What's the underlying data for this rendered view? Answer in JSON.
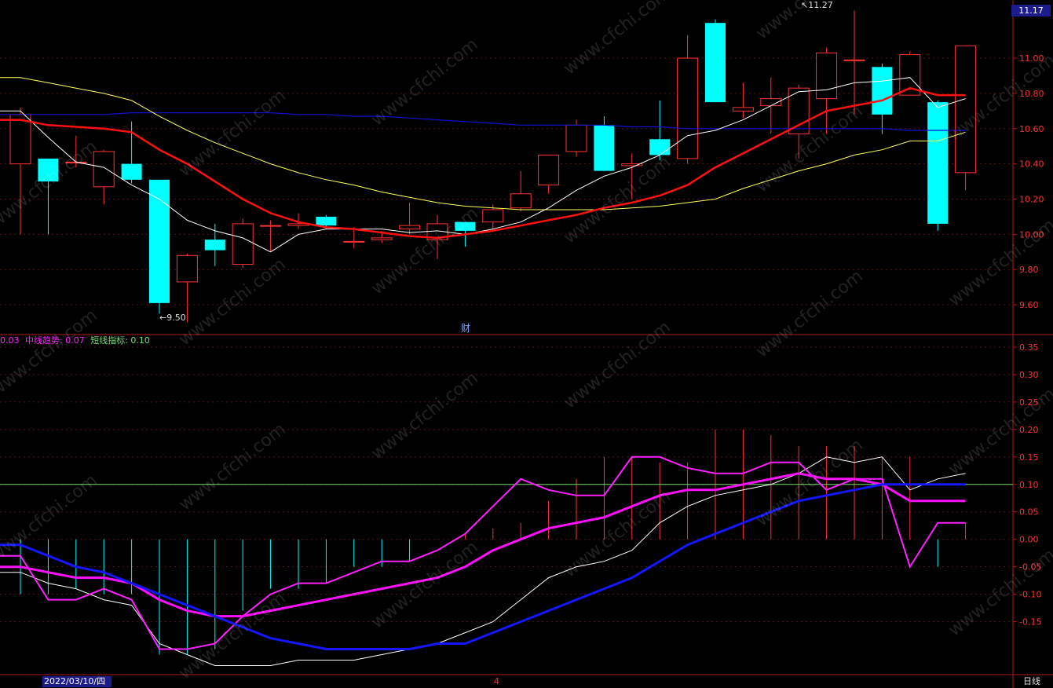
{
  "colors": {
    "up": "#ff3232",
    "down": "#00ffff",
    "ma5": "#ffffff",
    "ma10": "#ff1010",
    "ma20": "#ffff60",
    "ma60": "#1010d0",
    "grid": "#5a1010",
    "axis_text": "#ff3030",
    "ind_white": "#ffffff",
    "ind_magenta": "#ff10ff",
    "ind_purple": "#ff20ff",
    "ind_blue": "#1515ff",
    "ref_line": "#70e070"
  },
  "header": {
    "last_price": "11.17"
  },
  "chart_data": [
    {
      "type": "candlestick",
      "yticks": [
        "11.00",
        "10.80",
        "10.60",
        "10.40",
        "10.20",
        "10.00",
        "9.80",
        "9.60"
      ],
      "ylim": [
        9.44,
        11.33
      ],
      "high_marker": "11.27",
      "low_marker": "9.50",
      "candles": [
        {
          "o": 10.4,
          "h": 10.72,
          "l": 10.0,
          "c": 10.68
        },
        {
          "o": 10.43,
          "h": 10.43,
          "l": 10.0,
          "c": 10.3
        },
        {
          "o": 10.41,
          "h": 10.56,
          "l": 10.38,
          "c": 10.41
        },
        {
          "o": 10.27,
          "h": 10.48,
          "l": 10.17,
          "c": 10.47
        },
        {
          "o": 10.4,
          "h": 10.64,
          "l": 10.29,
          "c": 10.31
        },
        {
          "o": 10.31,
          "h": 10.31,
          "l": 9.55,
          "c": 9.61
        },
        {
          "o": 9.73,
          "h": 9.89,
          "l": 9.5,
          "c": 9.88
        },
        {
          "o": 9.97,
          "h": 10.06,
          "l": 9.82,
          "c": 9.91
        },
        {
          "o": 9.83,
          "h": 10.09,
          "l": 9.81,
          "c": 10.06
        },
        {
          "o": 10.05,
          "h": 10.08,
          "l": 9.9,
          "c": 10.05
        },
        {
          "o": 10.05,
          "h": 10.12,
          "l": 10.03,
          "c": 10.06
        },
        {
          "o": 10.1,
          "h": 10.11,
          "l": 10.03,
          "c": 10.05
        },
        {
          "o": 9.96,
          "h": 10.04,
          "l": 9.92,
          "c": 9.96
        },
        {
          "o": 9.97,
          "h": 10.02,
          "l": 9.95,
          "c": 9.98
        },
        {
          "o": 10.03,
          "h": 10.18,
          "l": 10.0,
          "c": 10.05
        },
        {
          "o": 9.97,
          "h": 10.11,
          "l": 9.86,
          "c": 10.06
        },
        {
          "o": 10.07,
          "h": 10.07,
          "l": 9.93,
          "c": 10.02
        },
        {
          "o": 10.07,
          "h": 10.17,
          "l": 10.03,
          "c": 10.14
        },
        {
          "o": 10.15,
          "h": 10.36,
          "l": 10.13,
          "c": 10.23
        },
        {
          "o": 10.28,
          "h": 10.44,
          "l": 10.23,
          "c": 10.45
        },
        {
          "o": 10.47,
          "h": 10.65,
          "l": 10.44,
          "c": 10.62
        },
        {
          "o": 10.62,
          "h": 10.67,
          "l": 10.37,
          "c": 10.36
        },
        {
          "o": 10.39,
          "h": 10.46,
          "l": 10.2,
          "c": 10.4
        },
        {
          "o": 10.54,
          "h": 10.76,
          "l": 10.42,
          "c": 10.45
        },
        {
          "o": 10.43,
          "h": 11.13,
          "l": 10.4,
          "c": 11.0
        },
        {
          "o": 11.2,
          "h": 11.22,
          "l": 10.75,
          "c": 10.75
        },
        {
          "o": 10.7,
          "h": 10.86,
          "l": 10.66,
          "c": 10.72
        },
        {
          "o": 10.73,
          "h": 10.89,
          "l": 10.57,
          "c": 10.77
        },
        {
          "o": 10.57,
          "h": 10.85,
          "l": 10.43,
          "c": 10.83
        },
        {
          "o": 10.77,
          "h": 11.06,
          "l": 10.57,
          "c": 11.03
        },
        {
          "o": 10.99,
          "h": 11.27,
          "l": 10.68,
          "c": 10.99
        },
        {
          "o": 10.95,
          "h": 10.97,
          "l": 10.57,
          "c": 10.68
        },
        {
          "o": 10.79,
          "h": 11.04,
          "l": 10.79,
          "c": 11.02
        },
        {
          "o": 10.75,
          "h": 10.76,
          "l": 10.02,
          "c": 10.06
        },
        {
          "o": 10.35,
          "h": 11.07,
          "l": 10.25,
          "c": 11.07
        }
      ],
      "ma5": [
        10.7,
        10.55,
        10.41,
        10.38,
        10.28,
        10.2,
        10.08,
        10.02,
        9.98,
        9.9,
        10.0,
        10.03,
        10.03,
        10.03,
        10.01,
        10.02,
        10.0,
        10.03,
        10.07,
        10.15,
        10.25,
        10.33,
        10.38,
        10.45,
        10.56,
        10.59,
        10.65,
        10.73,
        10.81,
        10.82,
        10.86,
        10.87,
        10.89,
        10.72,
        10.77
      ],
      "ma10": [
        10.65,
        10.62,
        10.61,
        10.6,
        10.58,
        10.48,
        10.4,
        10.3,
        10.2,
        10.12,
        10.07,
        10.04,
        10.03,
        10.01,
        9.99,
        9.98,
        10.0,
        10.02,
        10.05,
        10.08,
        10.11,
        10.15,
        10.18,
        10.22,
        10.28,
        10.38,
        10.46,
        10.54,
        10.62,
        10.7,
        10.73,
        10.76,
        10.83,
        10.79,
        10.79
      ],
      "ma20": [
        10.89,
        10.86,
        10.83,
        10.8,
        10.76,
        10.67,
        10.59,
        10.52,
        10.46,
        10.4,
        10.35,
        10.31,
        10.28,
        10.24,
        10.21,
        10.18,
        10.16,
        10.15,
        10.14,
        10.14,
        10.14,
        10.14,
        10.15,
        10.16,
        10.18,
        10.2,
        10.26,
        10.31,
        10.36,
        10.4,
        10.45,
        10.48,
        10.53,
        10.53,
        10.58
      ],
      "ma60": [
        10.68,
        10.68,
        10.68,
        10.68,
        10.69,
        10.69,
        10.69,
        10.69,
        10.69,
        10.69,
        10.68,
        10.68,
        10.67,
        10.67,
        10.66,
        10.65,
        10.64,
        10.63,
        10.62,
        10.62,
        10.62,
        10.62,
        10.61,
        10.61,
        10.6,
        10.6,
        10.6,
        10.6,
        10.6,
        10.6,
        10.6,
        10.6,
        10.59,
        10.59,
        10.59
      ]
    },
    {
      "type": "line",
      "legend": [
        {
          "text": "0.03",
          "color": "#ff20ff"
        },
        {
          "text": "中线趋势: 0.07",
          "color": "#ff20ff"
        },
        {
          "text": "短线指标: 0.10",
          "color": "#70e070"
        }
      ],
      "yticks": [
        "0.35",
        "0.30",
        "0.25",
        "0.20",
        "0.15",
        "0.10",
        "0.05",
        "0.00",
        "-0.05",
        "-0.10",
        "-0.15"
      ],
      "ylim": [
        -0.245,
        0.37
      ],
      "reference": 0.1,
      "bars": [
        -0.1,
        -0.1,
        -0.09,
        -0.1,
        -0.1,
        -0.21,
        -0.21,
        -0.2,
        -0.13,
        -0.09,
        -0.09,
        -0.08,
        -0.05,
        -0.05,
        -0.04,
        0.0,
        0.01,
        0.02,
        0.03,
        0.07,
        0.11,
        0.15,
        0.15,
        0.14,
        0.14,
        0.2,
        0.2,
        0.19,
        0.17,
        0.17,
        0.17,
        0.15,
        0.15,
        -0.05,
        0.03
      ],
      "series": [
        {
          "name": "white",
          "color": "#ffffff",
          "values": [
            -0.06,
            -0.08,
            -0.09,
            -0.11,
            -0.12,
            -0.19,
            -0.21,
            -0.23,
            -0.23,
            -0.23,
            -0.22,
            -0.22,
            -0.22,
            -0.21,
            -0.2,
            -0.19,
            -0.17,
            -0.15,
            -0.11,
            -0.07,
            -0.05,
            -0.04,
            -0.02,
            0.03,
            0.06,
            0.08,
            0.09,
            0.1,
            0.12,
            0.15,
            0.14,
            0.15,
            0.09,
            0.11,
            0.12
          ]
        },
        {
          "name": "pink",
          "color": "#ff20ff",
          "values": [
            -0.03,
            -0.11,
            -0.11,
            -0.09,
            -0.11,
            -0.2,
            -0.2,
            -0.19,
            -0.14,
            -0.1,
            -0.08,
            -0.08,
            -0.06,
            -0.04,
            -0.04,
            -0.02,
            0.01,
            0.06,
            0.11,
            0.09,
            0.08,
            0.08,
            0.15,
            0.15,
            0.13,
            0.12,
            0.12,
            0.14,
            0.14,
            0.09,
            0.11,
            0.11,
            -0.05,
            0.03,
            0.03
          ]
        },
        {
          "name": "magenta",
          "color": "#ff10ff",
          "values": [
            -0.05,
            -0.06,
            -0.07,
            -0.07,
            -0.08,
            -0.11,
            -0.13,
            -0.14,
            -0.14,
            -0.13,
            -0.12,
            -0.11,
            -0.1,
            -0.09,
            -0.08,
            -0.07,
            -0.05,
            -0.02,
            0.0,
            0.02,
            0.03,
            0.04,
            0.06,
            0.08,
            0.09,
            0.09,
            0.1,
            0.11,
            0.12,
            0.11,
            0.11,
            0.1,
            0.07,
            0.07,
            0.07
          ]
        },
        {
          "name": "blue",
          "color": "#1515ff",
          "values": [
            -0.01,
            -0.03,
            -0.05,
            -0.06,
            -0.08,
            -0.1,
            -0.12,
            -0.14,
            -0.16,
            -0.18,
            -0.19,
            -0.2,
            -0.2,
            -0.2,
            -0.2,
            -0.19,
            -0.19,
            -0.17,
            -0.15,
            -0.13,
            -0.11,
            -0.09,
            -0.07,
            -0.04,
            -0.01,
            0.01,
            0.03,
            0.05,
            0.07,
            0.08,
            0.09,
            0.1,
            0.1,
            0.1,
            0.1
          ]
        }
      ]
    }
  ],
  "footer": {
    "date": "2022/03/10/四",
    "month_marker": "4",
    "period": "日线"
  },
  "event_icon": "财",
  "watermark": "www.cfchi.com"
}
